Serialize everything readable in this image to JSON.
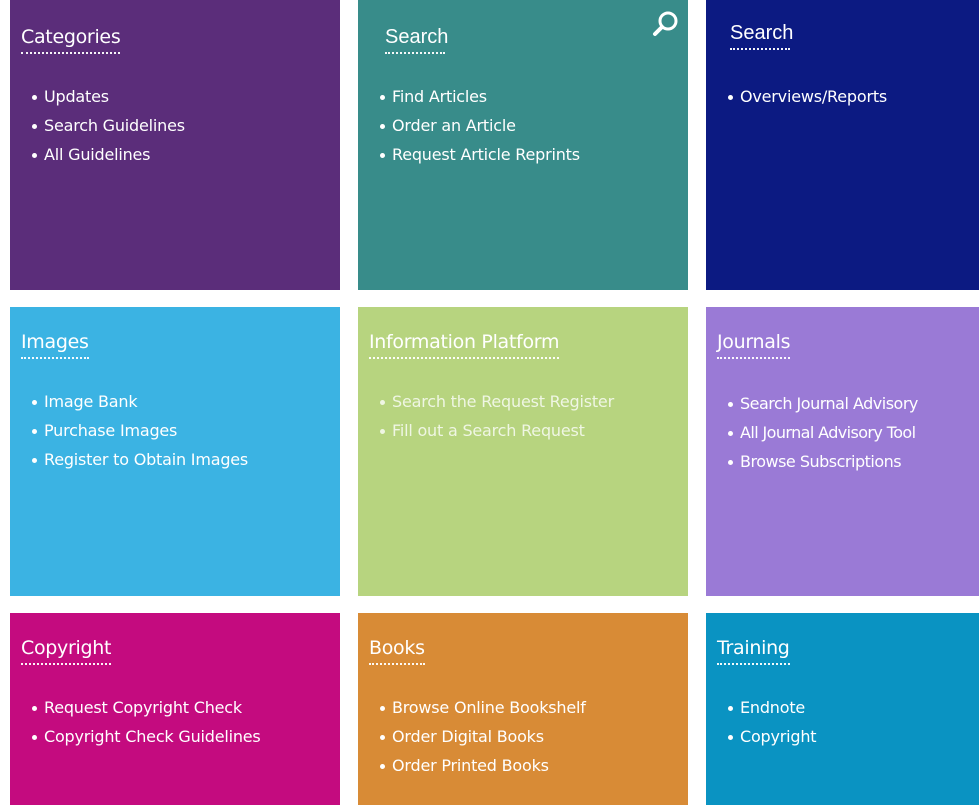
{
  "tiles": [
    {
      "title": "Categories",
      "color": "#5b2d7a",
      "items": [
        "Updates",
        "Search Guidelines",
        "All Guidelines"
      ]
    },
    {
      "title": "Search",
      "color": "#388c8a",
      "icon": "search-icon",
      "items": [
        "Find Articles",
        "Order an Article",
        "Request Article Reprints"
      ]
    },
    {
      "title": "Search",
      "color": "#0c1a82",
      "items": [
        "Overviews/Reports"
      ]
    },
    {
      "title": "Images",
      "color": "#3bb3e3",
      "items": [
        "Image Bank",
        "Purchase Images",
        "Register to Obtain Images"
      ]
    },
    {
      "title": "Information Platform",
      "color": "#b7d47f",
      "items": [
        "Search the Request Register",
        "Fill out a Search Request"
      ]
    },
    {
      "title": "Journals",
      "color": "#9a7ad6",
      "items": [
        "Search Journal Advisory",
        "All Journal Advisory Tool",
        "Browse Subscriptions"
      ]
    },
    {
      "title": "Copyright",
      "color": "#c40b7f",
      "items": [
        "Request Copyright Check",
        "Copyright Check Guidelines"
      ]
    },
    {
      "title": "Books",
      "color": "#d88b36",
      "items": [
        "Browse Online Bookshelf",
        "Order Digital Books",
        "Order Printed Books"
      ]
    },
    {
      "title": "Training",
      "color": "#0a93c2",
      "items": [
        "Endnote",
        "Copyright"
      ]
    }
  ]
}
